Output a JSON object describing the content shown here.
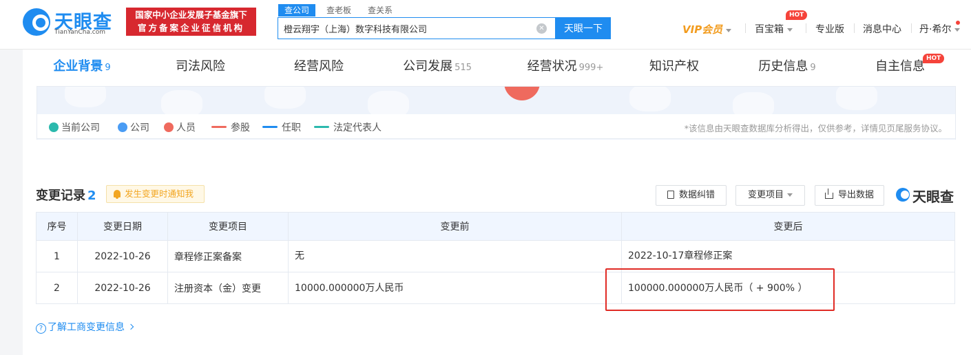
{
  "header": {
    "logo_text": "天眼查",
    "logo_sub": "TianYanCha.com",
    "badge_line1": "国家中小企业发展子基金旗下",
    "badge_line2": "官方备案企业征信机构",
    "search_tabs": [
      "查公司",
      "查老板",
      "查关系"
    ],
    "search_value": "橙云翔宇（上海）数字科技有限公司",
    "search_button": "天眼一下",
    "nav": {
      "vip": "VIP会员",
      "treasure": "百宝箱",
      "hot": "HOT",
      "pro": "专业版",
      "messages": "消息中心",
      "user": "丹·希尔"
    }
  },
  "tabs": [
    {
      "label": "企业背景",
      "count": "9"
    },
    {
      "label": "司法风险",
      "count": ""
    },
    {
      "label": "经营风险",
      "count": ""
    },
    {
      "label": "公司发展",
      "count": "515"
    },
    {
      "label": "经营状况",
      "count": "999+"
    },
    {
      "label": "知识产权",
      "count": ""
    },
    {
      "label": "历史信息",
      "count": "9"
    },
    {
      "label": "自主信息",
      "count": ""
    }
  ],
  "tab_hot": "HOT",
  "legend": {
    "items": [
      "当前公司",
      "公司",
      "人员",
      "参股",
      "任职",
      "法定代表人"
    ],
    "colors": [
      "#2bb9ad",
      "#4a9cf4",
      "#ef6a5e",
      "#ef6a5e",
      "#1f8cf0",
      "#2bb9ad"
    ],
    "disclaimer": "*该信息由天眼查数据库分析得出，仅供参考，详情见页尾服务协议。"
  },
  "changes": {
    "title": "变更记录",
    "count": "2",
    "notify": "发生变更时通知我",
    "buttons": {
      "correct": "数据纠错",
      "filter": "变更项目",
      "export": "导出数据"
    },
    "brand": "天眼查",
    "columns": [
      "序号",
      "变更日期",
      "变更项目",
      "变更前",
      "变更后"
    ],
    "rows": [
      {
        "no": "1",
        "date": "2022-10-26",
        "item": "章程修正案备案",
        "before": "无",
        "after": "2022-10-17章程修正案"
      },
      {
        "no": "2",
        "date": "2022-10-26",
        "item": "注册资本（金）变更",
        "before": "10000.000000万人民币",
        "after": "100000.000000万人民币（ + 900% ）"
      }
    ],
    "help": "了解工商变更信息"
  }
}
